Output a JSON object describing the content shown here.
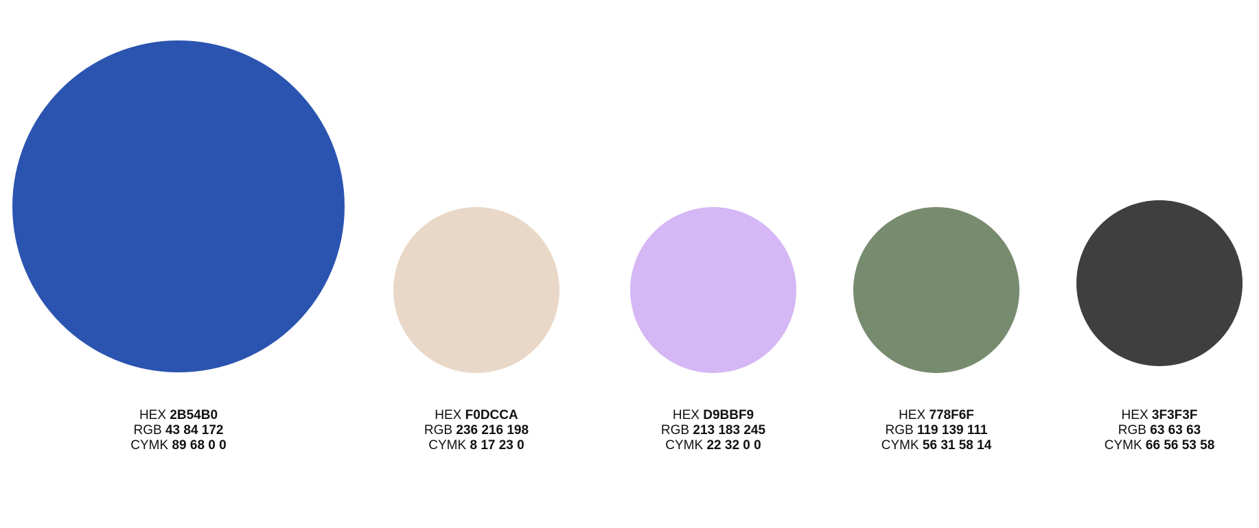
{
  "swatches": [
    {
      "hex": "2B54B0",
      "rgb": "43 84 172",
      "cymk": "89 68 0 0",
      "color": "#2B54B0"
    },
    {
      "hex": "F0DCCA",
      "rgb": "236 216 198",
      "cymk": "8 17 23 0",
      "color": "#E9D8C7"
    },
    {
      "hex": "D9BBF9",
      "rgb": "213 183 245",
      "cymk": "22 32 0 0",
      "color": "#D5B7F5"
    },
    {
      "hex": "778F6F",
      "rgb": "119 139 111",
      "cymk": "56 31 58 14",
      "color": "#778B6F"
    },
    {
      "hex": "3F3F3F",
      "rgb": "63 63 63",
      "cymk": "66 56 53 58",
      "color": "#3F3F3F"
    }
  ],
  "labels": {
    "hex": "HEX",
    "rgb": "RGB",
    "cymk": "CYMK"
  }
}
